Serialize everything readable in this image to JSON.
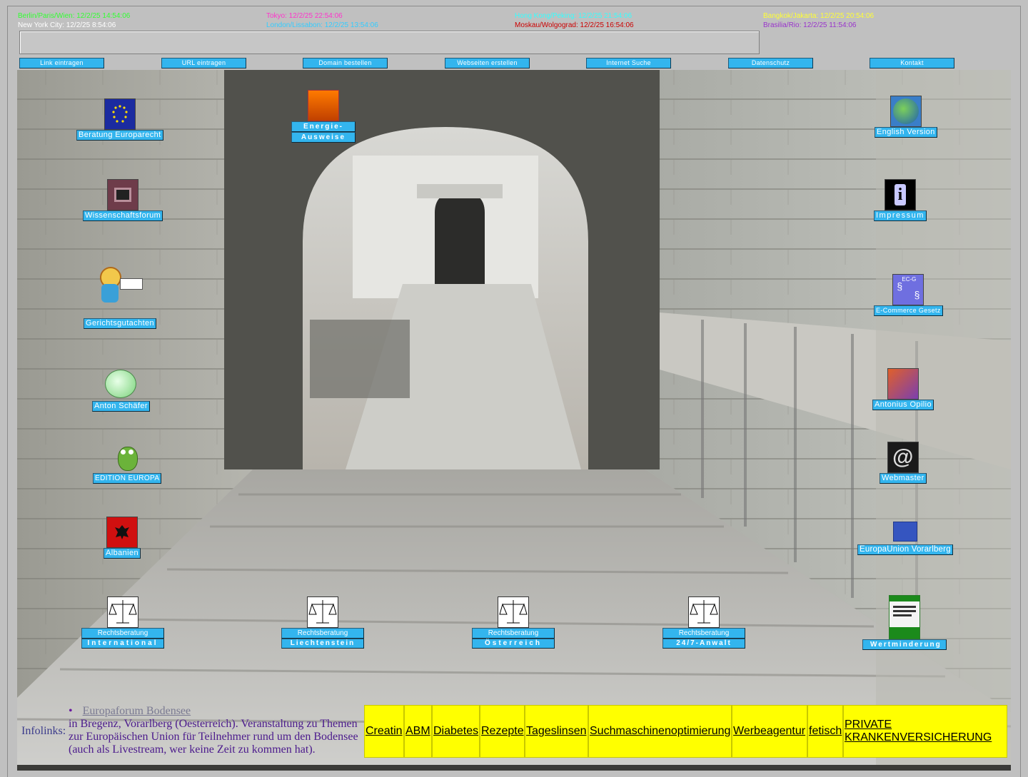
{
  "clocks": [
    {
      "text": "Berlin/Paris/Wien: 12/2/25 14:54:06",
      "color": "#33ff33"
    },
    {
      "text": "New York City: 12/2/25 8:54:06",
      "color": "#ffffff"
    },
    {
      "text": "Tokyo: 12/2/25 22:54:06",
      "color": "#ff33cc"
    },
    {
      "text": "London/Lissabon: 12/2/25 13:54:06",
      "color": "#33ccff"
    },
    {
      "text": "Hong Kong/Peking: 12/2/25 21:54:06",
      "color": "#33ffff"
    },
    {
      "text": "Moskau/Wolgograd: 12/2/25 16:54:06",
      "color": "#cc0000"
    },
    {
      "text": "Bangkok/Jakarta: 12/2/25 20:54:06",
      "color": "#ffff33"
    },
    {
      "text": "Brasilia/Rio: 12/2/25 11:54:06",
      "color": "#9933cc"
    }
  ],
  "nav": [
    "Link eintragen",
    "URL eintragen",
    "Domain bestellen",
    "Webseiten erstellen",
    "Internet Suche",
    "Datenschutz",
    "Kontakt"
  ],
  "icons_left": [
    {
      "label": "Beratung Europarecht",
      "icon": "eu-flag-icon"
    },
    {
      "label": "Wissenschaftsforum",
      "icon": "forum-icon"
    },
    {
      "label": "Gerichtsgutachten",
      "icon": "expert-worker-icon"
    },
    {
      "label": "Anton Schäfer",
      "icon": "globe-icon"
    },
    {
      "label": "EDITION EUROPA",
      "icon": "frog-icon"
    },
    {
      "label": "Albanien",
      "icon": "albania-flag-icon"
    }
  ],
  "energy": {
    "line1": "Energie-",
    "line2": "Ausweise",
    "icon": "flame-icon"
  },
  "icons_right": [
    {
      "label": "English Version",
      "icon": "earth-icon"
    },
    {
      "label": "Impressum",
      "icon": "info-icon"
    },
    {
      "label": "E-Commerce Gesetz",
      "icon": "paragraph-icon",
      "badge": "EC-G"
    },
    {
      "label": "Antonius Opilio",
      "icon": "opilio-icon"
    },
    {
      "label": "Webmaster",
      "icon": "at-icon"
    },
    {
      "label": "EuropaUnion Vorarlberg",
      "icon": "eu-flag-small-icon"
    }
  ],
  "rechtsberatung": [
    {
      "line1": "Rechtsberatung",
      "line2": "International"
    },
    {
      "line1": "Rechtsberatung",
      "line2": "Liechtenstein"
    },
    {
      "line1": "Rechtsberatung",
      "line2": "Österreich"
    },
    {
      "line1": "Rechtsberatung",
      "line2": "24/7-Anwalt"
    }
  ],
  "wertminderung": {
    "label": "Wertminderung",
    "icon": "book-icon"
  },
  "infolinks": {
    "key": "Infolinks:",
    "item": "Europaforum Bodensee",
    "desc": "in Bregenz, Vorarlberg (Oesterreich). Veranstaltung zu Themen zur Europäischen Union für Teilnehmer rund um den Bodensee (auch als Livestream, wer keine Zeit zu kommen hat)."
  },
  "adlinks": [
    "Creatin",
    "ABM",
    "Diabetes",
    "Rezepte",
    "Tageslinsen",
    "Suchmaschinenoptimierung",
    "Werbeagentur",
    "fetisch",
    "PRIVATE KRANKENVERSICHERUNG"
  ]
}
